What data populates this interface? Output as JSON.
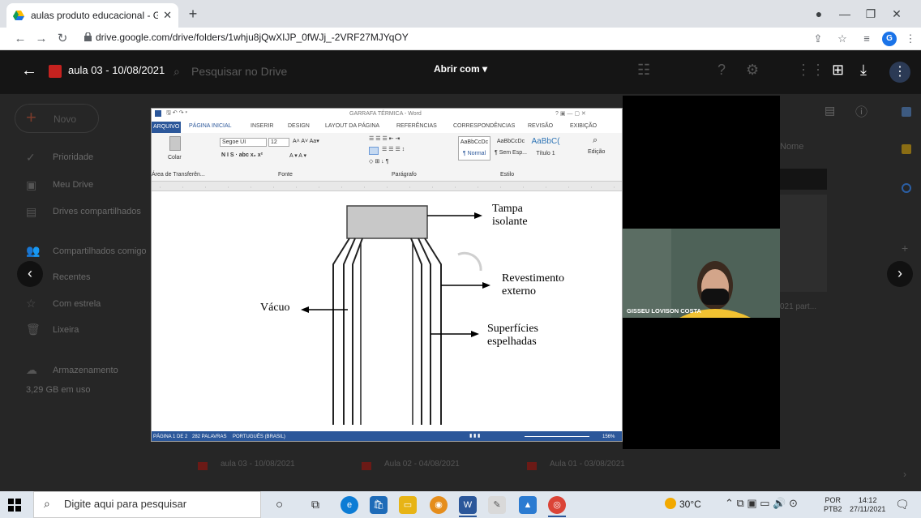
{
  "browser": {
    "tab_title": "aulas produto educacional - Goo",
    "url": "drive.google.com/drive/folders/1whju8jQwXIJP_0fWJj_-2VRF27MJYqOY",
    "profile_initial": "G"
  },
  "viewer": {
    "doc_title": "aula 03 - 10/08/2021",
    "open_with": "Abrir com",
    "search_placeholder": "Pesquisar no Drive"
  },
  "drive": {
    "new_label": "Novo",
    "sidebar": [
      "Prioridade",
      "Meu Drive",
      "Drives compartilhados",
      "Compartilhados comigo",
      "Recentes",
      "Com estrela",
      "Lixeira",
      "Armazenamento"
    ],
    "storage_text": "3,29 GB em uso",
    "files": [
      "aula 03 - 10/08/2021",
      "Aula 02 - 04/08/2021",
      "Aula 01 - 03/08/2021"
    ],
    "name_sort": "Nome",
    "partial_file": "021 part..."
  },
  "word": {
    "title": "GARRAFA TÉRMICA - Word",
    "tabs": [
      "ARQUIVO",
      "PÁGINA INICIAL",
      "INSERIR",
      "DESIGN",
      "LAYOUT DA PÁGINA",
      "REFERÊNCIAS",
      "CORRESPONDÊNCIAS",
      "REVISÃO",
      "EXIBIÇÃO"
    ],
    "font_name": "Segoe UI",
    "font_size": "12",
    "paste_label": "Colar",
    "group_labels": [
      "Área de Transferên...",
      "Fonte",
      "Parágrafo",
      "Estilo",
      "Edição"
    ],
    "styles": [
      "AaBbCcDc",
      "AaBbCcDc",
      "AaBbC("
    ],
    "style_names": [
      "¶ Normal",
      "¶ Sem Esp...",
      "Título 1"
    ],
    "status": [
      "PÁGINA 1 DE 2",
      "282 PALAVRAS",
      "PORTUGUÊS (BRASIL)",
      "156%"
    ]
  },
  "diagram": {
    "labels": {
      "tampa": [
        "Tampa",
        "isolante"
      ],
      "revestimento": [
        "Revestimento",
        "externo"
      ],
      "vacuo": "Vácuo",
      "superficies": [
        "Superfícies",
        "espelhadas"
      ]
    }
  },
  "video": {
    "participant": "GISSEU LOVISON COSTA"
  },
  "taskbar": {
    "search_placeholder": "Digite aqui para pesquisar",
    "temperature": "30°C",
    "lang_line1": "POR",
    "lang_line2": "PTB2",
    "time": "14:12",
    "date": "27/11/2021"
  }
}
